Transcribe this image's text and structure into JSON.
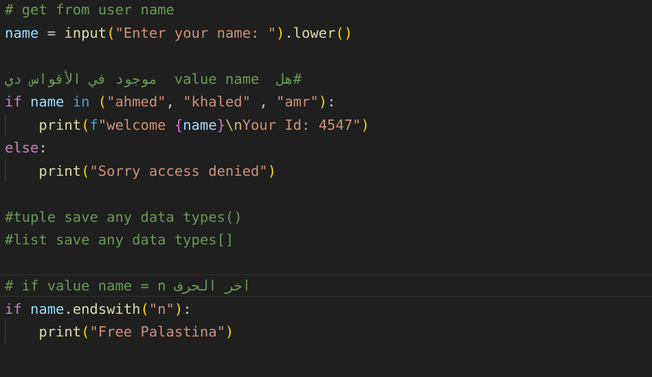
{
  "editor": {
    "lines": [
      {
        "tokens": [
          [
            "comment",
            "# get from user name"
          ]
        ]
      },
      {
        "tokens": [
          [
            "var",
            "name"
          ],
          [
            "punc",
            " = "
          ],
          [
            "fn",
            "input"
          ],
          [
            "br1",
            "("
          ],
          [
            "str",
            "\"Enter your name: \""
          ],
          [
            "br1",
            ")"
          ],
          [
            "punc",
            "."
          ],
          [
            "fn",
            "lower"
          ],
          [
            "br1",
            "()"
          ]
        ]
      },
      {
        "tokens": []
      },
      {
        "tokens": [
          [
            "comment",
            "#هل  value name  موجود في الأقواس دي"
          ]
        ]
      },
      {
        "tokens": [
          [
            "kw",
            "if"
          ],
          [
            "punc",
            " "
          ],
          [
            "var",
            "name"
          ],
          [
            "punc",
            " "
          ],
          [
            "kw-blue",
            "in"
          ],
          [
            "punc",
            " "
          ],
          [
            "br1",
            "("
          ],
          [
            "str",
            "\"ahmed\""
          ],
          [
            "punc",
            ", "
          ],
          [
            "str",
            "\"khaled\""
          ],
          [
            "punc",
            " , "
          ],
          [
            "str",
            "\"amr\""
          ],
          [
            "br1",
            ")"
          ],
          [
            "punc",
            ":"
          ]
        ]
      },
      {
        "tokens": [
          [
            "punc",
            "    "
          ],
          [
            "fn",
            "print"
          ],
          [
            "br1",
            "("
          ],
          [
            "kw-blue",
            "f"
          ],
          [
            "str",
            "\"welcome "
          ],
          [
            "br2",
            "{"
          ],
          [
            "var",
            "name"
          ],
          [
            "br2",
            "}"
          ],
          [
            "esc",
            "\\n"
          ],
          [
            "str",
            "Your Id: 4547\""
          ],
          [
            "br1",
            ")"
          ]
        ]
      },
      {
        "tokens": [
          [
            "kw",
            "else"
          ],
          [
            "punc",
            ":"
          ]
        ]
      },
      {
        "tokens": [
          [
            "punc",
            "    "
          ],
          [
            "fn",
            "print"
          ],
          [
            "br1",
            "("
          ],
          [
            "str",
            "\"Sorry access denied\""
          ],
          [
            "br1",
            ")"
          ]
        ]
      },
      {
        "tokens": []
      },
      {
        "tokens": [
          [
            "comment",
            "#tuple save any data types()"
          ]
        ]
      },
      {
        "tokens": [
          [
            "comment",
            "#list save any data types[]"
          ]
        ]
      },
      {
        "tokens": []
      },
      {
        "tokens": [
          [
            "comment",
            "# if value name = n اخر الحرف"
          ]
        ]
      },
      {
        "tokens": [
          [
            "kw",
            "if"
          ],
          [
            "punc",
            " "
          ],
          [
            "var",
            "name"
          ],
          [
            "punc",
            "."
          ],
          [
            "fn",
            "endswith"
          ],
          [
            "br1",
            "("
          ],
          [
            "str",
            "\"n\""
          ],
          [
            "br1",
            ")"
          ],
          [
            "punc",
            ":"
          ]
        ]
      },
      {
        "tokens": [
          [
            "punc",
            "    "
          ],
          [
            "fn",
            "print"
          ],
          [
            "br1",
            "("
          ],
          [
            "str",
            "\"Free Palastina\""
          ],
          [
            "br1",
            ")"
          ]
        ]
      }
    ]
  }
}
